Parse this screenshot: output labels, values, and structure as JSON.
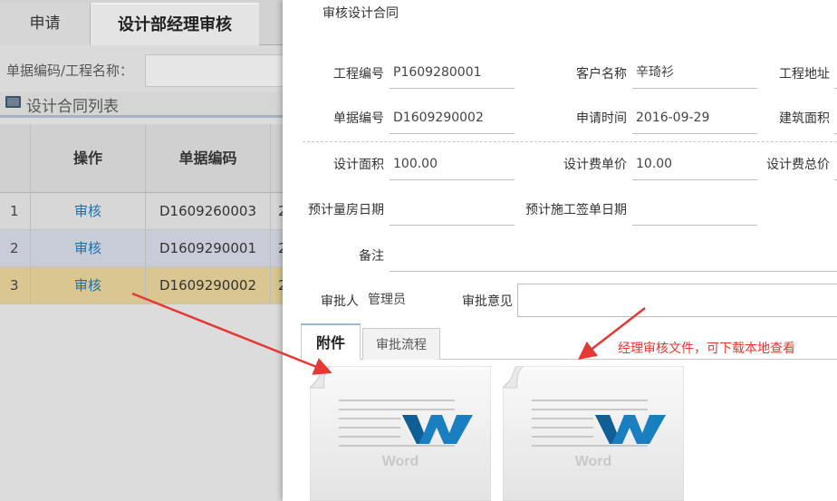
{
  "tabs": [
    {
      "label": "申请"
    },
    {
      "label": "设计部经理审核"
    }
  ],
  "search": {
    "label": "单据编码/工程名称：",
    "value": ""
  },
  "list": {
    "title": "设计合同列表"
  },
  "grid": {
    "headers": [
      "操作",
      "单据编码"
    ],
    "rows": [
      {
        "num": "1",
        "op": "审核",
        "code": "D1609260003",
        "extra": "2"
      },
      {
        "num": "2",
        "op": "审核",
        "code": "D1609290001",
        "extra": "2"
      },
      {
        "num": "3",
        "op": "审核",
        "code": "D1609290002",
        "extra": "2"
      }
    ]
  },
  "modal": {
    "title": "审核设计合同",
    "fields": {
      "project_no": {
        "label": "工程编号",
        "value": "P1609280001"
      },
      "customer": {
        "label": "客户名称",
        "value": "辛琦衫"
      },
      "site": {
        "label": "工程地址",
        "value": ""
      },
      "doc_no": {
        "label": "单据编号",
        "value": "D1609290002"
      },
      "apply_time": {
        "label": "申请时间",
        "value": "2016-09-29"
      },
      "build_area": {
        "label": "建筑面积",
        "value": ""
      },
      "design_area": {
        "label": "设计面积",
        "value": "100.00"
      },
      "unit_price": {
        "label": "设计费单价",
        "value": "10.00"
      },
      "total_price": {
        "label": "设计费总价",
        "value": ""
      },
      "measure_date": {
        "label": "预计量房日期",
        "value": ""
      },
      "sign_date": {
        "label": "预计施工签单日期",
        "value": ""
      },
      "note": {
        "label": "备注",
        "value": ""
      },
      "approver": {
        "label": "审批人",
        "value": "管理员"
      },
      "opinion": {
        "label": "审批意见",
        "value": ""
      }
    },
    "att_tabs": [
      "附件",
      "审批流程"
    ],
    "files": [
      {
        "icon": "word-document-icon",
        "caption": "Word"
      },
      {
        "icon": "word-document-icon",
        "caption": "Word"
      }
    ]
  },
  "annotation": "经理审核文件，可下载本地查看",
  "colors": {
    "link": "#1e6fa8",
    "annotation": "#e53935",
    "selected_row": "#d9c690",
    "word_blue": "#1a7fc1"
  }
}
